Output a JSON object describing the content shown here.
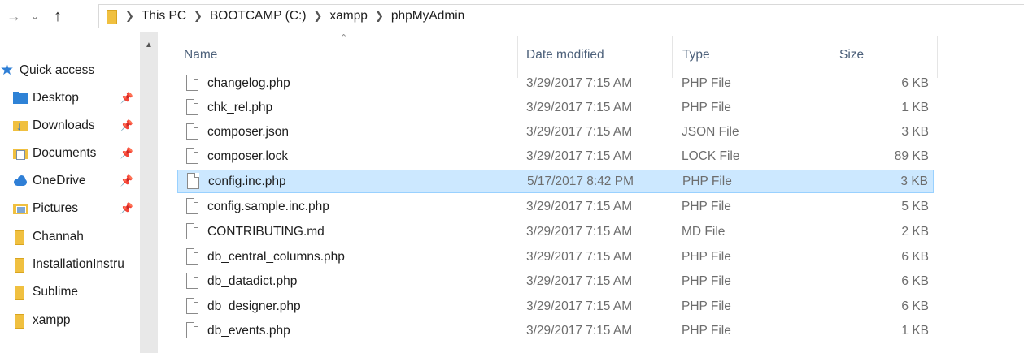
{
  "breadcrumb": [
    "This PC",
    "BOOTCAMP (C:)",
    "xampp",
    "phpMyAdmin"
  ],
  "icons": {
    "back": "back-arrow-icon",
    "recent": "chevron-down-icon",
    "up": "up-arrow-icon",
    "pin": "pin-icon"
  },
  "colors": {
    "selected_row_bg": "#cce8ff",
    "selected_row_border": "#99d1ff",
    "header_text": "#4c607a",
    "quick_access_star": "#2f7fd6"
  },
  "nav": {
    "quick_access": "Quick access",
    "items": [
      {
        "label": "Desktop",
        "pinned": true
      },
      {
        "label": "Downloads",
        "pinned": true
      },
      {
        "label": "Documents",
        "pinned": true
      },
      {
        "label": "OneDrive",
        "pinned": true
      },
      {
        "label": "Pictures",
        "pinned": true
      },
      {
        "label": "Channah",
        "pinned": false
      },
      {
        "label": "InstallationInstru",
        "pinned": false
      },
      {
        "label": "Sublime",
        "pinned": false
      },
      {
        "label": "xampp",
        "pinned": false
      }
    ]
  },
  "columns": {
    "name": "Name",
    "date": "Date modified",
    "type": "Type",
    "size": "Size"
  },
  "files": [
    {
      "name": "changelog.php",
      "date": "3/29/2017 7:15 AM",
      "type": "PHP File",
      "size": "6 KB"
    },
    {
      "name": "chk_rel.php",
      "date": "3/29/2017 7:15 AM",
      "type": "PHP File",
      "size": "1 KB"
    },
    {
      "name": "composer.json",
      "date": "3/29/2017 7:15 AM",
      "type": "JSON File",
      "size": "3 KB"
    },
    {
      "name": "composer.lock",
      "date": "3/29/2017 7:15 AM",
      "type": "LOCK File",
      "size": "89 KB"
    },
    {
      "name": "config.inc.php",
      "date": "5/17/2017 8:42 PM",
      "type": "PHP File",
      "size": "3 KB",
      "selected": true
    },
    {
      "name": "config.sample.inc.php",
      "date": "3/29/2017 7:15 AM",
      "type": "PHP File",
      "size": "5 KB"
    },
    {
      "name": "CONTRIBUTING.md",
      "date": "3/29/2017 7:15 AM",
      "type": "MD File",
      "size": "2 KB"
    },
    {
      "name": "db_central_columns.php",
      "date": "3/29/2017 7:15 AM",
      "type": "PHP File",
      "size": "6 KB"
    },
    {
      "name": "db_datadict.php",
      "date": "3/29/2017 7:15 AM",
      "type": "PHP File",
      "size": "6 KB"
    },
    {
      "name": "db_designer.php",
      "date": "3/29/2017 7:15 AM",
      "type": "PHP File",
      "size": "6 KB"
    },
    {
      "name": "db_events.php",
      "date": "3/29/2017 7:15 AM",
      "type": "PHP File",
      "size": "1 KB"
    }
  ]
}
